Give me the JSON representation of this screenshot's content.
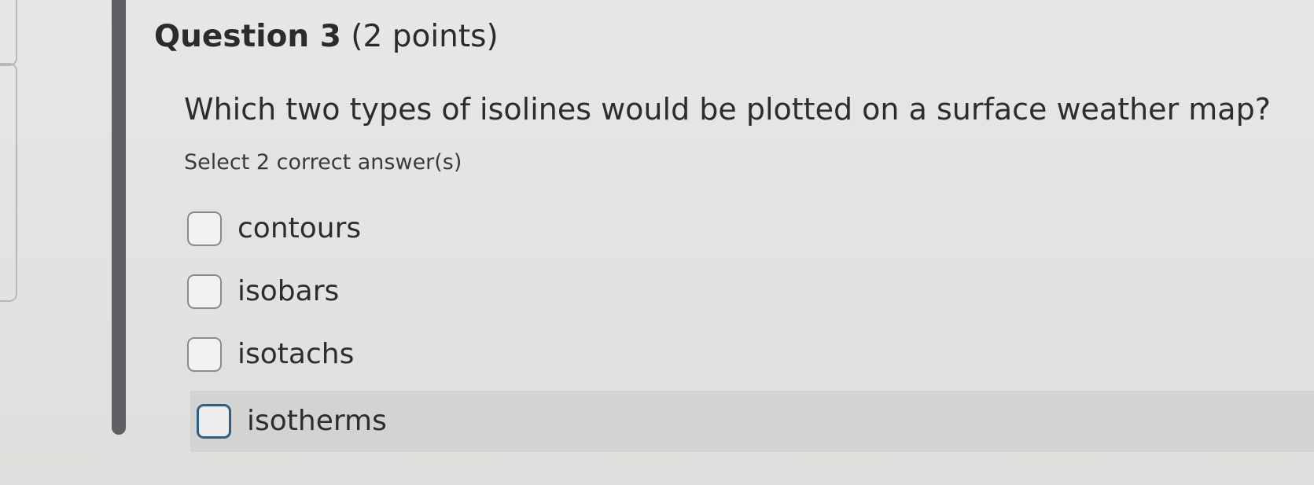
{
  "question": {
    "number_label": "Question 3",
    "points_label": "(2 points)",
    "prompt": "Which two types of isolines would be plotted on a surface weather map?",
    "instruction": "Select 2 correct answer(s)"
  },
  "options": [
    {
      "label": "contours",
      "checked": false
    },
    {
      "label": "isobars",
      "checked": false
    },
    {
      "label": "isotachs",
      "checked": false
    },
    {
      "label": "isotherms",
      "checked": false,
      "focused": true
    }
  ],
  "colors": {
    "accent_bar": "#5f6063",
    "focus_outline": "#2c5f88",
    "hover_background": "#d3d3d1"
  }
}
